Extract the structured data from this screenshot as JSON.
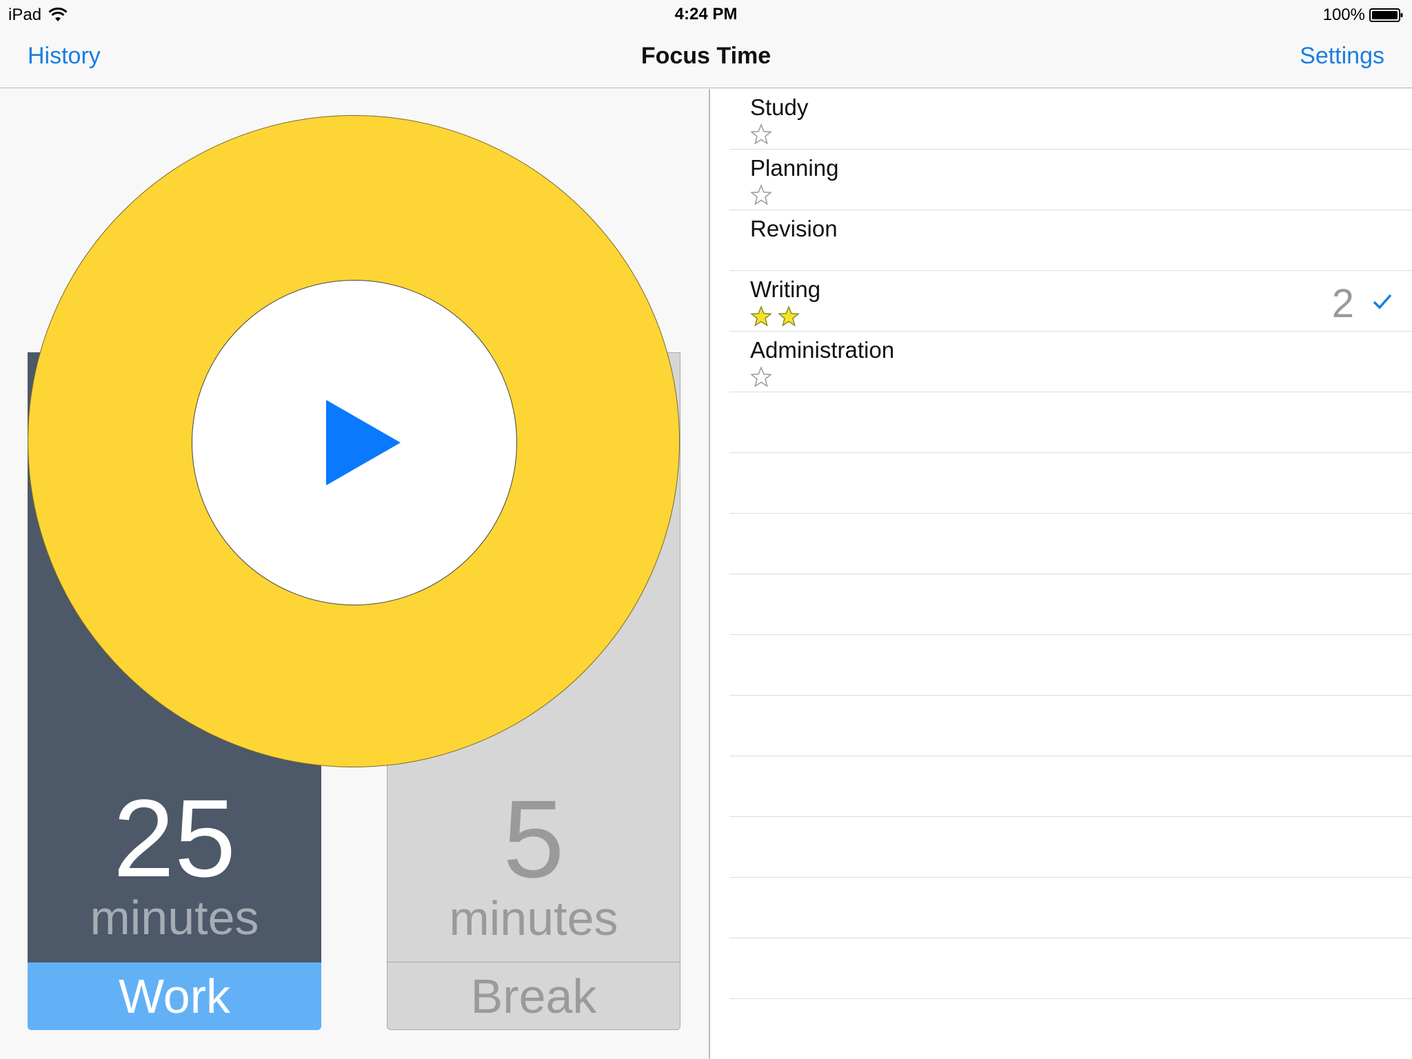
{
  "status_bar": {
    "device": "iPad",
    "time": "4:24 PM",
    "battery": "100%"
  },
  "nav": {
    "left": "History",
    "title": "Focus Time",
    "right": "Settings"
  },
  "timers": {
    "work": {
      "value": "25",
      "unit": "minutes",
      "label": "Work"
    },
    "break": {
      "value": "5",
      "unit": "minutes",
      "label": "Break"
    }
  },
  "tasks": [
    {
      "name": "Study",
      "stars": 1,
      "filled": 0
    },
    {
      "name": "Planning",
      "stars": 1,
      "filled": 0
    },
    {
      "name": "Revision",
      "stars": 0,
      "filled": 0
    },
    {
      "name": "Writing",
      "stars": 2,
      "filled": 2,
      "count": "2",
      "selected": true
    },
    {
      "name": "Administration",
      "stars": 1,
      "filled": 0
    }
  ],
  "colors": {
    "accent": "#1a7ee0",
    "ring": "#fdd535",
    "play": "#0a79fd",
    "work_card": "#4d5868",
    "work_label": "#62b1f6",
    "star_filled": "#f5e22a"
  },
  "icons": {
    "wifi": "wifi-icon",
    "battery": "battery-icon",
    "play": "play-icon",
    "star": "star-icon",
    "check": "checkmark-icon"
  }
}
